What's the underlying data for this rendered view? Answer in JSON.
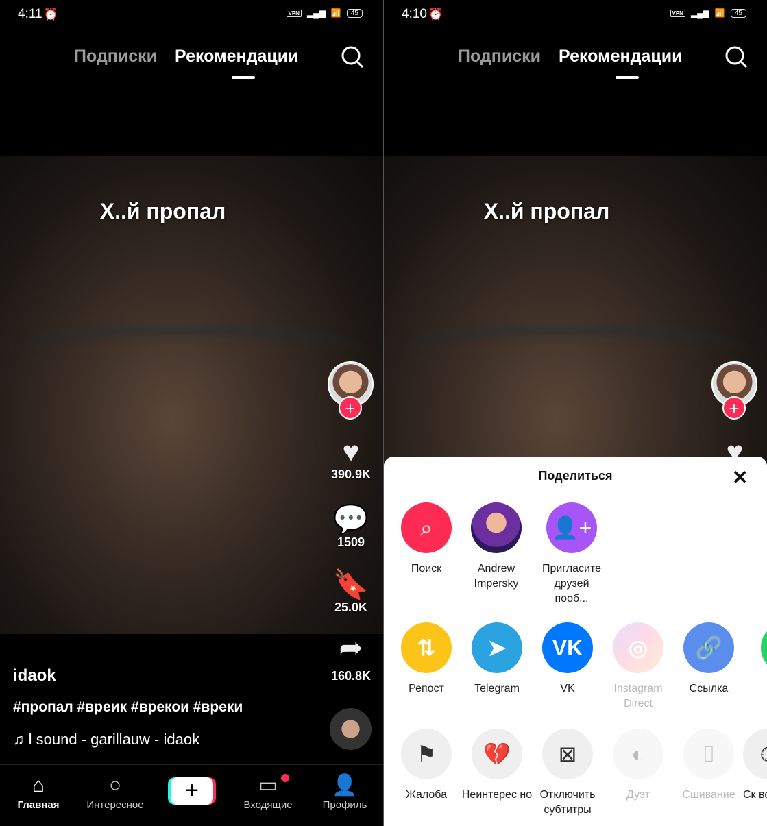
{
  "screens": [
    {
      "status": {
        "time": "4:11",
        "vpn": "VPN",
        "battery": "45"
      }
    },
    {
      "status": {
        "time": "4:10",
        "vpn": "VPN",
        "battery": "45"
      }
    }
  ],
  "top_tabs": {
    "following": "Подписки",
    "for_you": "Рекомендации"
  },
  "video": {
    "overlay_text": "Х..й пропал",
    "username": "idaok",
    "hashtags": "#пропал #вреик #врекои #вреки",
    "sound": "♫ l sound - garillauw - idaok"
  },
  "actions": {
    "likes": "390.9K",
    "comments": "1509",
    "bookmarks": "25.0K",
    "shares": "160.8K"
  },
  "nav": {
    "home": "Главная",
    "discover": "Интересное",
    "create": "+",
    "inbox": "Входящие",
    "profile": "Профиль"
  },
  "share_sheet": {
    "title": "Поделиться",
    "close": "✕",
    "row1": [
      {
        "label": "Поиск",
        "icon": "search-icon",
        "color": "#fe2c55"
      },
      {
        "label": "Andrew Impersky",
        "icon": "avatar"
      },
      {
        "label": "Пригласите друзей пооб...",
        "icon": "add-user-icon",
        "color": "#a855f7"
      }
    ],
    "row2": [
      {
        "label": "Репост",
        "color": "#fcc419"
      },
      {
        "label": "Telegram",
        "color": "#2aa3e0"
      },
      {
        "label": "VK",
        "color": "#0077ff"
      },
      {
        "label": "Instagram Direct",
        "disabled": true
      },
      {
        "label": "Ссылка",
        "color": "#5b8def"
      }
    ],
    "row3": [
      {
        "label": "Жалоба"
      },
      {
        "label": "Неинтерес но"
      },
      {
        "label": "Отключить субтитры"
      },
      {
        "label": "Дуэт",
        "disabled": true
      },
      {
        "label": "Сшивание",
        "disabled": true
      },
      {
        "label": "Ск восп"
      }
    ]
  },
  "colors": {
    "accent": "#fe2c55",
    "cyan": "#25f4ee"
  }
}
